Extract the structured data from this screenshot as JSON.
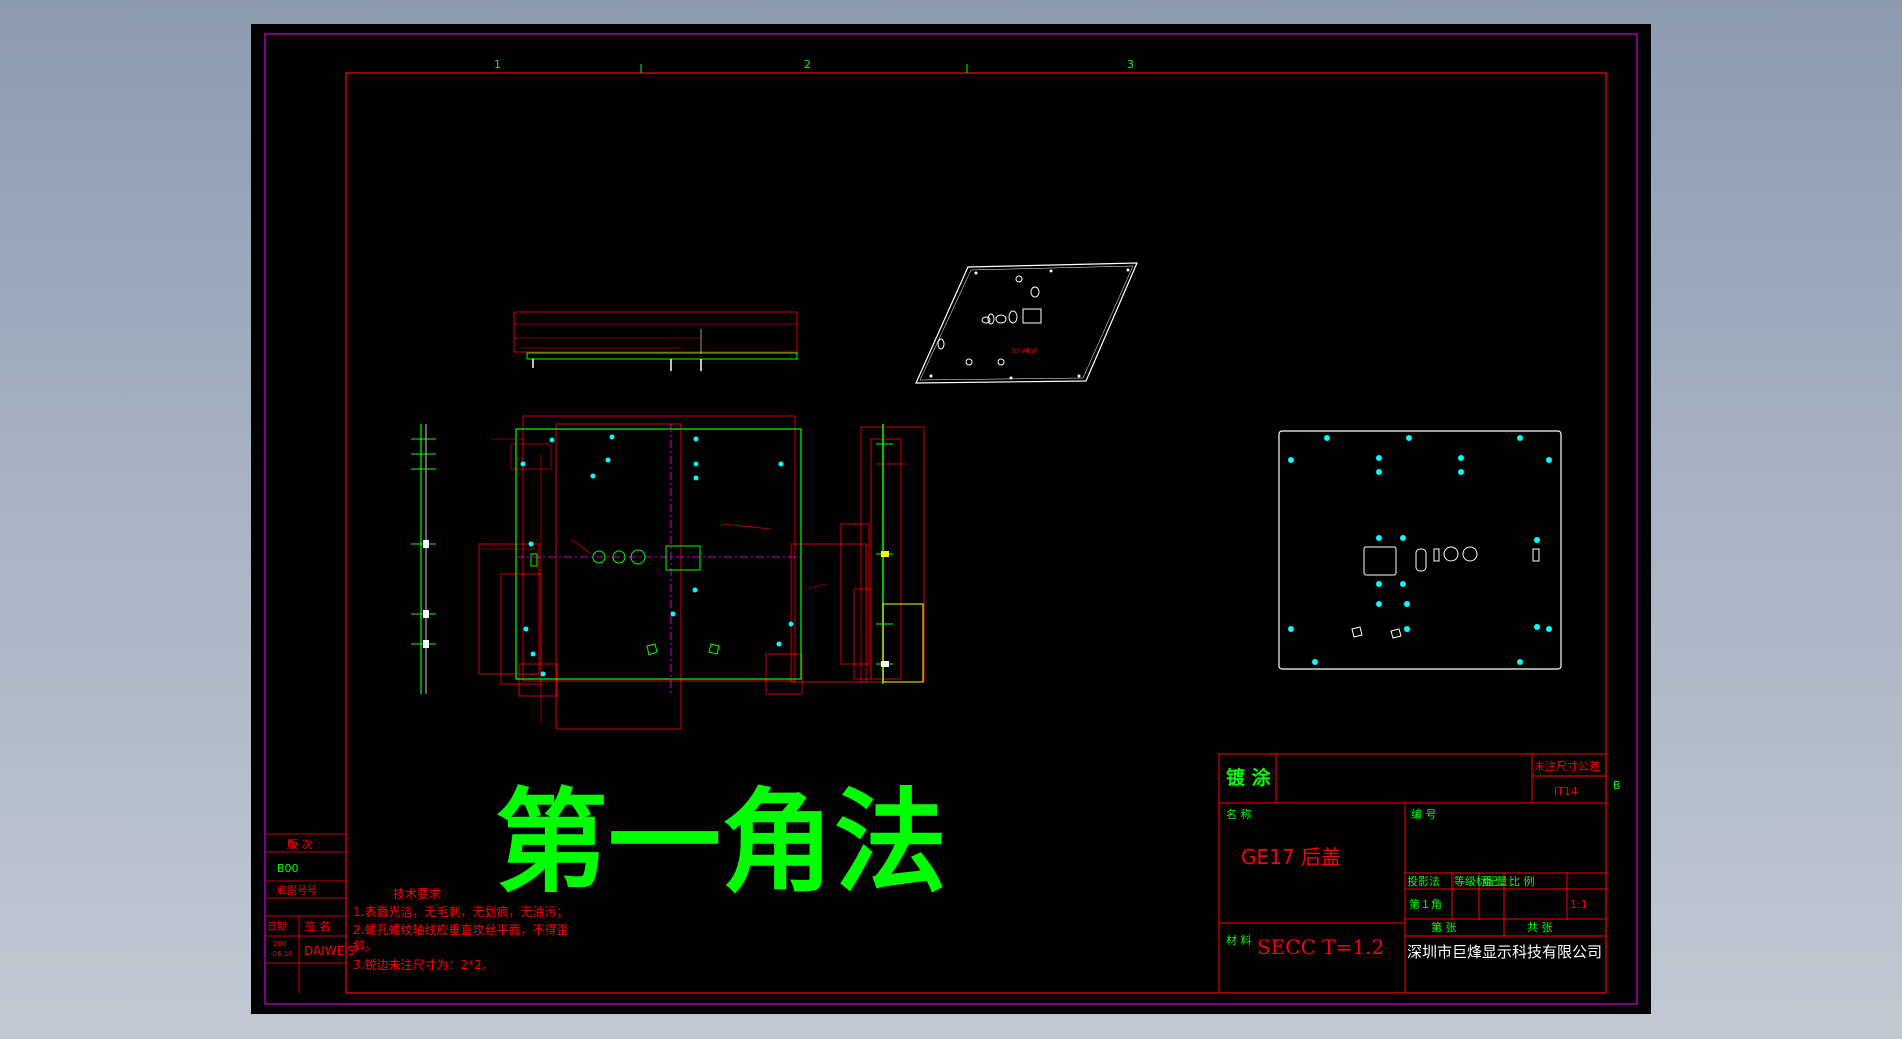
{
  "zones": [
    "1",
    "2",
    "3"
  ],
  "zone_b": "B",
  "big_title": "第一角法",
  "view_label_3d": "3D VIEW",
  "tech": {
    "heading": "技术要求",
    "line1": "1.表面光洁，无毛刺，无划痕，无油污；",
    "line2": "2.螺孔螺纹轴线应垂直攻丝平面，不得歪",
    "line2b": "斜。",
    "line3": "3.锐边未注尺寸为：2*2。"
  },
  "revision_block": {
    "version_label": "版 次",
    "version_value": "B00",
    "drawing_no_label": "底图号号",
    "date_label": "日期",
    "sign_label": "签 名",
    "date_value_1": "200",
    "date_value_2": "-06.16",
    "signer": "DAIWEIS"
  },
  "title_block": {
    "plating_label": "镀 涂",
    "tolerance_label": "未注尺寸公差",
    "tolerance_value": "IT14",
    "name_label": "名 称",
    "part_name": "GE17 后盖",
    "number_label": "编 号",
    "projection_label": "投影法",
    "grade_label": "等级标记",
    "weight_label": "重 量",
    "scale_label": "比 例",
    "projection_value": "第１角",
    "scale_value": "1:1",
    "material_label": "材 料",
    "material_value": "SECC T=1.2",
    "sheet_label": "第 张",
    "total_label": "共 张",
    "company": "深圳市巨烽显示科技有限公司"
  },
  "colors": {
    "frame": "#ff0000",
    "outer_frame": "#ff00ff",
    "title_green": "#00ff00",
    "part_lines": "#00ff00",
    "text_red": "#ff0000",
    "cyan": "#00ffff",
    "yellow": "#ffff00",
    "white": "#ffffff"
  }
}
